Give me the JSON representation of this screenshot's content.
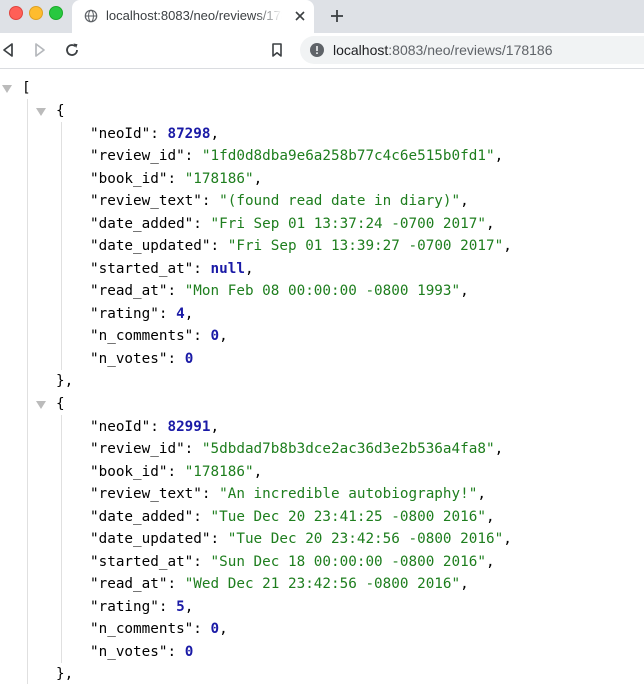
{
  "browser": {
    "tab_title": "localhost:8083/neo/reviews/178186",
    "url_host": "localhost",
    "url_rest": ":8083/neo/reviews/178186",
    "colors": {
      "close": "#ff5f57",
      "minimize": "#febc2e",
      "maximize": "#28c840"
    }
  },
  "json_view": {
    "open_bracket": "[",
    "open_brace": "{",
    "close_brace_comma": "},",
    "reviews": [
      {
        "neoId": "87298",
        "review_id": "\"1fd0d8dba9e6a258b77c4c6e515b0fd1\"",
        "book_id": "\"178186\"",
        "review_text": "\"(found read date in diary)\"",
        "date_added": "\"Fri Sep 01 13:37:24 -0700 2017\"",
        "date_updated": "\"Fri Sep 01 13:39:27 -0700 2017\"",
        "started_at": "null",
        "read_at": "\"Mon Feb 08 00:00:00 -0800 1993\"",
        "rating": "4",
        "n_comments": "0",
        "n_votes": "0"
      },
      {
        "neoId": "82991",
        "review_id": "\"5dbdad7b8b3dce2ac36d3e2b536a4fa8\"",
        "book_id": "\"178186\"",
        "review_text": "\"An incredible autobiography!\"",
        "date_added": "\"Tue Dec 20 23:41:25 -0800 2016\"",
        "date_updated": "\"Tue Dec 20 23:42:56 -0800 2016\"",
        "started_at": "\"Sun Dec 18 00:00:00 -0800 2016\"",
        "read_at": "\"Wed Dec 21 23:42:56 -0800 2016\"",
        "rating": "5",
        "n_comments": "0",
        "n_votes": "0"
      }
    ]
  }
}
